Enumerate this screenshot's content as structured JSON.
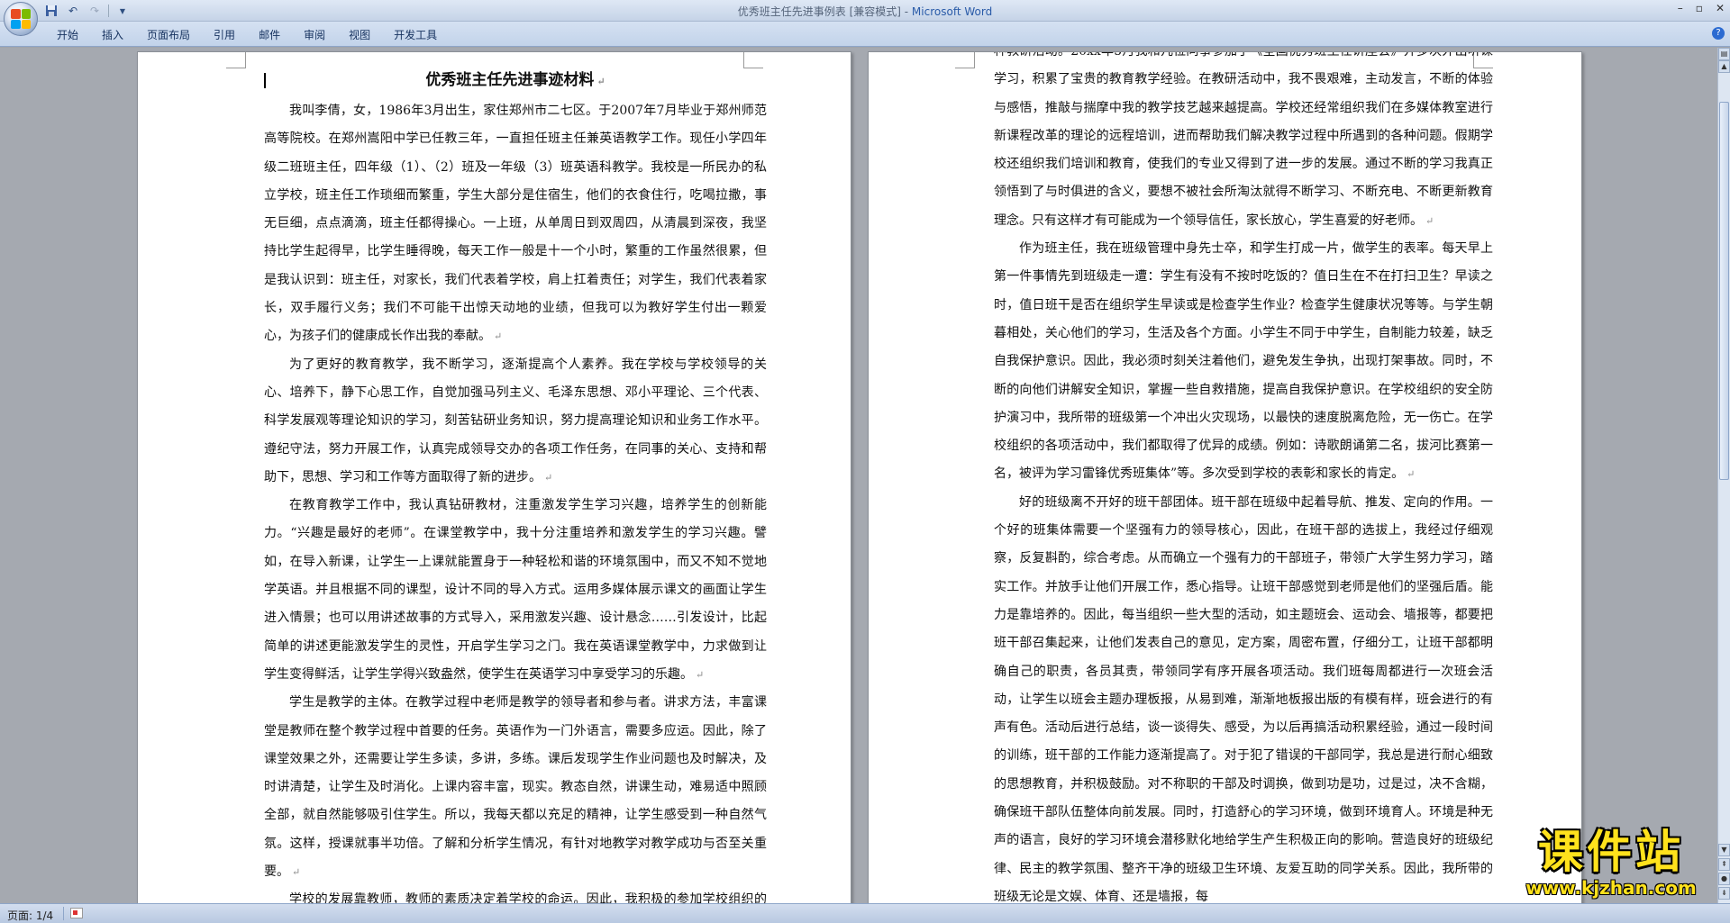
{
  "window": {
    "title_main": "优秀班主任先进事例表 [兼容模式] - ",
    "title_app": "Microsoft Word"
  },
  "ribbon": {
    "tabs": [
      "开始",
      "插入",
      "页面布局",
      "引用",
      "邮件",
      "审阅",
      "视图",
      "开发工具"
    ]
  },
  "document": {
    "title": "优秀班主任先进事迹材料",
    "page1_paragraphs": [
      "我叫李倩，女，1986年3月出生，家住郑州市二七区。于2007年7月毕业于郑州师范高等院校。在郑州嵩阳中学已任教三年，一直担任班主任兼英语教学工作。现任小学四年级二班班主任，四年级（1）、（2）班及一年级（3）班英语科教学。我校是一所民办的私立学校，班主任工作琐细而繁重，学生大部分是住宿生，他们的衣食住行，吃喝拉撒，事无巨细，点点滴滴，班主任都得操心。一上班，从单周日到双周四，从清晨到深夜，我坚持比学生起得早，比学生睡得晚，每天工作一般是十一个小时，繁重的工作虽然很累，但是我认识到：班主任，对家长，我们代表着学校，肩上扛着责任；对学生，我们代表着家长，双手履行义务；我们不可能干出惊天动地的业绩，但我可以为教好学生付出一颗爱心，为孩子们的健康成长作出我的奉献。",
      "为了更好的教育教学，我不断学习，逐渐提高个人素养。我在学校与学校领导的关心、培养下，静下心思工作，自觉加强马列主义、毛泽东思想、邓小平理论、三个代表、科学发展观等理论知识的学习，刻苦钻研业务知识，努力提高理论知识和业务工作水平。遵纪守法，努力开展工作，认真完成领导交办的各项工作任务，在同事的关心、支持和帮助下，思想、学习和工作等方面取得了新的进步。",
      "在教育教学工作中，我认真钻研教材，注重激发学生学习兴趣，培养学生的创新能力。“兴趣是最好的老师”。在课堂教学中，我十分注重培养和激发学生的学习兴趣。譬如，在导入新课，让学生一上课就能置身于一种轻松和谐的环境氛围中，而又不知不觉地学英语。并且根据不同的课型，设计不同的导入方式。运用多媒体展示课文的画面让学生进入情景；也可以用讲述故事的方式导入，采用激发兴趣、设计悬念……引发设计，比起简单的讲述更能激发学生的灵性，开启学生学习之门。我在英语课堂教学中，力求做到让学生变得鲜活，让学生学得兴致盎然，使学生在英语学习中享受学习的乐趣。",
      "学生是教学的主体。在教学过程中老师是教学的领导者和参与者。讲求方法，丰富课堂是教师在整个教学过程中首要的任务。英语作为一门外语言，需要多应运。因此，除了课堂效果之外，还需要让学生多读，多讲，多练。课后发现学生作业问题也及时解决，及时讲清楚，让学生及时消化。上课内容丰富，现实。教态自然，讲课生动，难易适中照顾全部，就自然能够吸引住学生。所以，我每天都以充足的精神，让学生感受到一种自然气氛。这样，授课就事半功倍。了解和分析学生情况，有针对地教学对教学成功与否至关重要。",
      "学校的发展靠教师，教师的素质决定着学校的命运。因此，我积极的参加学校组织的各"
    ],
    "page2_paragraphs": [
      "种教研活动。20xx年5月我和几位同事参加了《全国优秀班主任讲座会》并多次外出听课学习，积累了宝贵的教育教学经验。在教研活动中，我不畏艰难，主动发言，不断的体验与感悟，推敲与揣摩中我的教学技艺越来越提高。学校还经常组织我们在多媒体教室进行新课程改革的理论的远程培训，进而帮助我们解决教学过程中所遇到的各种问题。假期学校还组织我们培训和教育，使我们的专业又得到了进一步的发展。通过不断的学习我真正领悟到了与时俱进的含义，要想不被社会所淘汰就得不断学习、不断充电、不断更新教育理念。只有这样才有可能成为一个领导信任，家长放心，学生喜爱的好老师。",
      "作为班主任，我在班级管理中身先士卒，和学生打成一片，做学生的表率。每天早上第一件事情先到班级走一遭：学生有没有不按时吃饭的？值日生在不在打扫卫生？早读之时，值日班干是否在组织学生早读或是检查学生作业？检查学生健康状况等等。与学生朝暮相处，关心他们的学习，生活及各个方面。小学生不同于中学生，自制能力较差，缺乏自我保护意识。因此，我必须时刻关注着他们，避免发生争执，出现打架事故。同时，不断的向他们讲解安全知识，掌握一些自救措施，提高自我保护意识。在学校组织的安全防护演习中，我所带的班级第一个冲出火灾现场，以最快的速度脱离危险，无一伤亡。在学校组织的各项活动中，我们都取得了优异的成绩。例如：诗歌朗诵第二名，拔河比赛第一名，被评为学习雷锋优秀班集体”等。多次受到学校的表彰和家长的肯定。",
      "好的班级离不开好的班干部团体。班干部在班级中起着导航、推发、定向的作用。一个好的班集体需要一个坚强有力的领导核心，因此，在班干部的选拔上，我经过仔细观察，反复斟酌，综合考虑。从而确立一个强有力的干部班子，带领广大学生努力学习，踏实工作。并放手让他们开展工作，悉心指导。让班干部感觉到老师是他们的坚强后盾。能力是靠培养的。因此，每当组织一些大型的活动，如主题班会、运动会、墙报等，都要把班干部召集起来，让他们发表自己的意见，定方案，周密布置，仔细分工，让班干部都明确自己的职责，各员其责，带领同学有序开展各项活动。我们班每周都进行一次班会活动，让学生以班会主题办理板报，从易到难，渐渐地板报出版的有模有样，班会进行的有声有色。活动后进行总结，谈一谈得失、感受，为以后再搞活动积累经验，通过一段时间的训练，班干部的工作能力逐渐提高了。对于犯了错误的干部同学，我总是进行耐心细致的思想教育，并积极鼓励。对不称职的干部及时调换，做到功是功，过是过，决不含糊，确保班干部队伍整体向前发展。同时，打造舒心的学习环境，做到环境育人。环境是种无声的语言，良好的学习环境会潜移默化地给学生产生积极正向的影响。营造良好的班级纪律、民主的教学氛围、整齐干净的班级卫生环境、友爱互助的同学关系。因此，我所带的班级无论是文娱、体育、还是墙报，每"
    ]
  },
  "status": {
    "page_info": "页面: 1/4"
  },
  "watermark": {
    "title": "课件站",
    "url": "www.kjzhan.com"
  },
  "icons": {
    "office_button": "office-logo-icon",
    "save": "save-icon",
    "undo": "undo-icon",
    "redo": "redo-icon",
    "help": "help-icon"
  },
  "colors": {
    "accent": "#2a5ba8",
    "watermark": "#ffe21c"
  }
}
